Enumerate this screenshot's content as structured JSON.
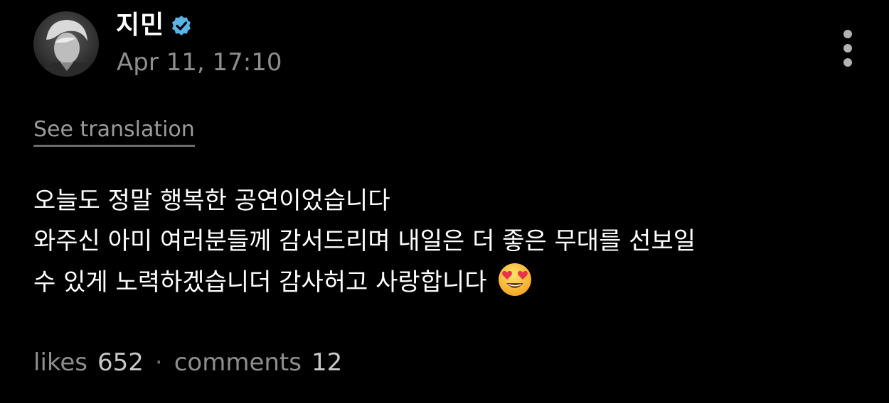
{
  "post": {
    "author": {
      "name": "지민",
      "verified": true,
      "avatar_icon": "avatar-photo"
    },
    "timestamp": "Apr 11, 17:10",
    "menu_icon": "more-vertical-icon",
    "translate_label": "See translation",
    "body_lines": [
      "오늘도 정말 행복한 공연이었습니다",
      "와주신 아미 여러분들께 감서드리며 내일은 더 좋은 무대를 선보일",
      "수 있게 노력하겠습니더 감사허고 사랑합니다"
    ],
    "emoji": "heart-eyes-emoji",
    "stats": {
      "likes_label": "likes",
      "likes_count": "652",
      "separator": "·",
      "comments_label": "comments",
      "comments_count": "12"
    },
    "colors": {
      "background": "#000000",
      "primary_text": "#ffffff",
      "secondary_text": "#8e8e8e",
      "verified_badge": "#5ab4e8"
    }
  }
}
